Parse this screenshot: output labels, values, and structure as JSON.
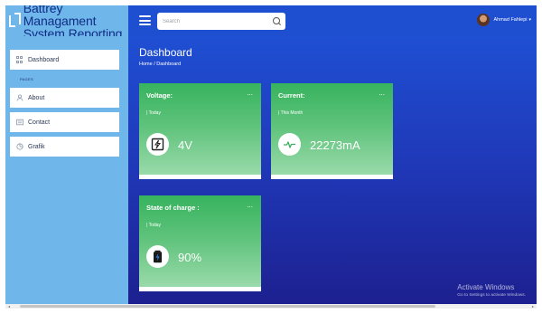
{
  "app": {
    "title_line1": "Battrey Managament",
    "title_line2": "System Reporting"
  },
  "header": {
    "search_placeholder": "Search",
    "user_name": "Ahmad Fahlepi",
    "user_caret": "▾"
  },
  "sidebar": {
    "pages_label": "PAGES",
    "items": [
      {
        "label": "Dashboard",
        "icon": "grid-icon"
      },
      {
        "label": "About",
        "icon": "person-icon"
      },
      {
        "label": "Contact",
        "icon": "contact-card-icon"
      },
      {
        "label": "Grafik",
        "icon": "chart-icon"
      }
    ]
  },
  "main": {
    "title": "Dashboard",
    "breadcrumb": "Home / Dashboard",
    "cards": [
      {
        "title": "Voltage:",
        "subtitle": "| Today",
        "value": "4V",
        "icon": "voltage-icon"
      },
      {
        "title": "Current:",
        "subtitle": "| This Month",
        "value": "22273mA",
        "icon": "pulse-icon"
      },
      {
        "title": "State of charge :",
        "subtitle": "| Today",
        "value": "90%",
        "icon": "battery-charging-icon"
      }
    ],
    "card_menu": "..."
  },
  "windows_notice": {
    "line1": "Activate Windows",
    "line2": "Go to Settings to activate Windows."
  },
  "colors": {
    "header_blue": "#1e4fd1",
    "sidebar_light_blue": "#6fb6ea",
    "card_green": "#37b35e"
  }
}
